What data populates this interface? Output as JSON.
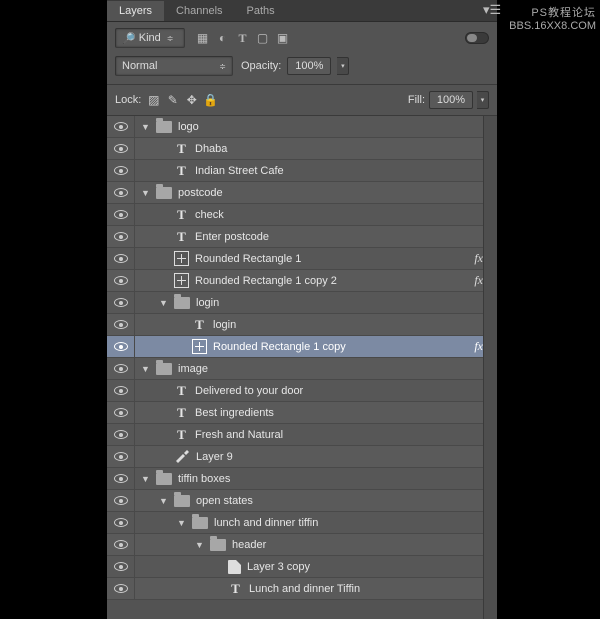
{
  "watermark": {
    "line1": "PS教程论坛",
    "line2": "BBS.16XX8.COM"
  },
  "tabs": {
    "layers": "Layers",
    "channels": "Channels",
    "paths": "Paths"
  },
  "toolbar": {
    "kind": "Kind",
    "blend_mode": "Normal",
    "opacity_label": "Opacity:",
    "opacity_value": "100%",
    "lock_label": "Lock:",
    "fill_label": "Fill:",
    "fill_value": "100%"
  },
  "layers": [
    {
      "indent": 0,
      "type": "group",
      "name": "logo",
      "expanded": true
    },
    {
      "indent": 1,
      "type": "text",
      "name": "Dhaba"
    },
    {
      "indent": 1,
      "type": "text",
      "name": "Indian Street Cafe"
    },
    {
      "indent": 0,
      "type": "group",
      "name": "postcode",
      "expanded": true
    },
    {
      "indent": 1,
      "type": "text",
      "name": "check"
    },
    {
      "indent": 1,
      "type": "text",
      "name": "Enter postcode"
    },
    {
      "indent": 1,
      "type": "shape",
      "name": "Rounded Rectangle 1",
      "fx": true
    },
    {
      "indent": 1,
      "type": "shape",
      "name": "Rounded Rectangle 1 copy 2",
      "fx": true
    },
    {
      "indent": 1,
      "type": "group",
      "name": "login",
      "expanded": true
    },
    {
      "indent": 2,
      "type": "text",
      "name": "login"
    },
    {
      "indent": 2,
      "type": "shape",
      "name": "Rounded Rectangle 1 copy",
      "fx": true,
      "selected": true
    },
    {
      "indent": 0,
      "type": "group",
      "name": "image",
      "expanded": true
    },
    {
      "indent": 1,
      "type": "text",
      "name": "Delivered to your door"
    },
    {
      "indent": 1,
      "type": "text",
      "name": "Best ingredients"
    },
    {
      "indent": 1,
      "type": "text",
      "name": "Fresh and Natural"
    },
    {
      "indent": 1,
      "type": "brush",
      "name": "Layer 9"
    },
    {
      "indent": 0,
      "type": "group",
      "name": "tiffin boxes",
      "expanded": true
    },
    {
      "indent": 1,
      "type": "group",
      "name": "open states",
      "expanded": true
    },
    {
      "indent": 2,
      "type": "group",
      "name": "lunch and dinner tiffin",
      "expanded": true
    },
    {
      "indent": 3,
      "type": "group",
      "name": "header",
      "expanded": true
    },
    {
      "indent": 4,
      "type": "smart",
      "name": "Layer 3 copy"
    },
    {
      "indent": 4,
      "type": "text",
      "name": "Lunch and dinner Tiffin"
    }
  ]
}
